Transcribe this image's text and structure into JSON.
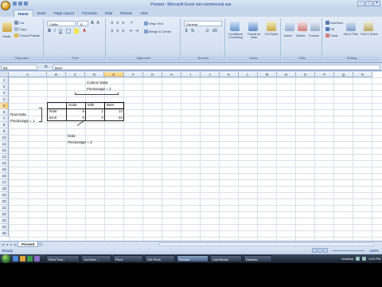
{
  "window": {
    "title": "Pivoted - Microsoft Excel non-commercial use",
    "controls": [
      "–",
      "□",
      "✕"
    ]
  },
  "ribbon": {
    "tabs": [
      "Home",
      "Insert",
      "Page Layout",
      "Formulas",
      "Data",
      "Review",
      "View"
    ],
    "clipboard": {
      "paste": "Paste",
      "cut": "Cut",
      "copy": "Copy",
      "format_painter": "Format Painter",
      "label": "Clipboard"
    },
    "font": {
      "name": "Calibri",
      "size": "11",
      "label": "Font"
    },
    "alignment": {
      "wrap": "Wrap Text",
      "merge": "Merge & Center",
      "label": "Alignment"
    },
    "number": {
      "format": "General",
      "label": "Number"
    },
    "styles": {
      "conditional": "Conditional Formatting",
      "format_table": "Format as Table",
      "cell_styles": "Cell Styles",
      "label": "Styles"
    },
    "cells": {
      "insert": "Insert",
      "delete": "Delete",
      "format": "Format",
      "label": "Cells"
    },
    "editing": {
      "autosum": "AutoSum",
      "fill": "Fill",
      "clear": "Clear",
      "sort": "Sort & Filter",
      "find": "Find & Select",
      "label": "Editing"
    }
  },
  "formula_bar": {
    "name_box": "E5",
    "fx": "fx",
    "content": "Beer"
  },
  "sheet": {
    "columns": [
      "A",
      "B",
      "C",
      "D",
      "E",
      "F",
      "G",
      "H",
      "I",
      "J",
      "K",
      "L",
      "M",
      "N",
      "O",
      "P",
      "Q",
      "R"
    ],
    "selected_column": "E",
    "rows": [
      "1",
      "2",
      "3",
      "4",
      "5",
      "6",
      "7",
      "8",
      "9",
      "10",
      "11",
      "12",
      "13",
      "14",
      "15",
      "16",
      "17",
      "18",
      "19",
      "20",
      "21",
      "22",
      "23",
      "24",
      "25"
    ],
    "selected_row": "5",
    "annotations": {
      "column_data": "Column Data",
      "pivot_usage_2": "PivotUsage = 2",
      "row_data": "Row Data",
      "pivot_usage_1": "PivotUsage = 1",
      "data": "Data",
      "pivot_usage_3": "PivotUsage = 3"
    },
    "table": {
      "headers": [
        "Soda",
        "Milk",
        "Beer"
      ],
      "rows": [
        {
          "label": "Rate",
          "values": [
            "6",
            "1",
            "12"
          ]
        },
        {
          "label": "Emil",
          "values": [
            "0",
            "0",
            "34"
          ]
        }
      ]
    }
  },
  "sheet_tabs": {
    "active": "Pivoted"
  },
  "status": {
    "text": "Ready",
    "zoom": "100%"
  },
  "taskbar": {
    "buttons": [
      "Pivot Tran...",
      "YouTube -...",
      "Pivot",
      "SID Pivot",
      "Pivoted",
      "CamStudio",
      "Desktop"
    ],
    "tray_text": "Desktop",
    "clock": "3:00 PM"
  }
}
